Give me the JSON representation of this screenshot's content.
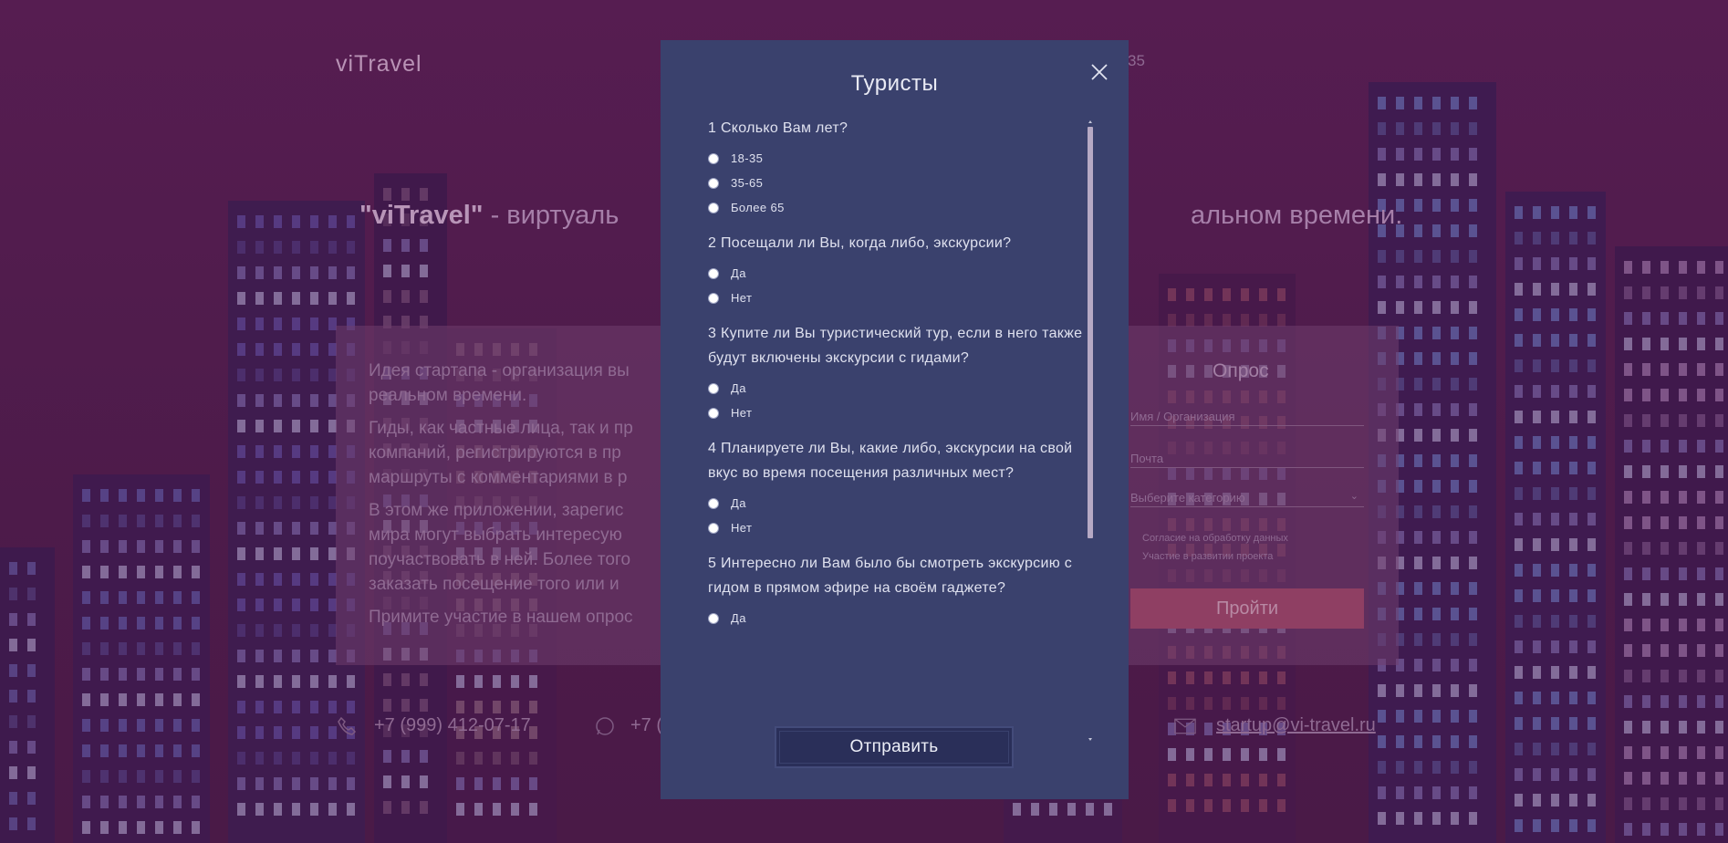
{
  "background": {
    "logo": "viTravel",
    "top_number": "35",
    "hero_brand": "\"viTravel\"",
    "hero_text_left": " - виртуаль",
    "hero_text_right": "альном времени.",
    "about_paragraphs": [
      "Идея стартапа - организация вы",
      "реальном времени.",
      "Гиды, как частные лица, так и пр",
      "компаний, регистрируются в пр",
      "маршруты с комментариями в р",
      "В этом же приложении, зарегис",
      "мира могут выбрать интересую",
      "поучаствовать в ней. Более того",
      "заказать посещение того или и",
      "Примите участие в нашем опрос"
    ],
    "survey": {
      "title": "Опрос",
      "name_placeholder": "Имя / Организация",
      "email_placeholder": "Почта",
      "category_placeholder": "Выберите категорию",
      "consent_label": "Согласие на обработку данных",
      "participation_label": "Участие в развитии проекта",
      "go_button": "Пройти"
    },
    "contacts": {
      "phone": "+7 (999) 412-07-17",
      "whatsapp": "+7 (",
      "email": "startup@vi-travel.ru"
    }
  },
  "modal": {
    "title": "Туристы",
    "questions": [
      {
        "text": "1 Сколько Вам лет?",
        "options": [
          "18-35",
          "35-65",
          "Более 65"
        ]
      },
      {
        "text": "2 Посещали ли Вы, когда либо, экскурсии?",
        "options": [
          "Да",
          "Нет"
        ]
      },
      {
        "text": "3 Купите ли Вы туристический тур, если в него также будут включены экскурсии с гидами?",
        "options": [
          "Да",
          "Нет"
        ]
      },
      {
        "text": "4 Планируете ли Вы, какие либо, экскурсии на свой вкус во время посещения различных мест?",
        "options": [
          "Да",
          "Нет"
        ]
      },
      {
        "text": "5 Интересно ли Вам было бы смотреть экскурсию с гидом в прямом эфире на своём гаджете?",
        "options": [
          "Да"
        ]
      }
    ],
    "submit_label": "Отправить",
    "scroll_position": 0.0
  },
  "colors": {
    "overlay": "#4f1c4c",
    "modal_bg": "#3a416d",
    "button_bg": "#2a2f59"
  }
}
